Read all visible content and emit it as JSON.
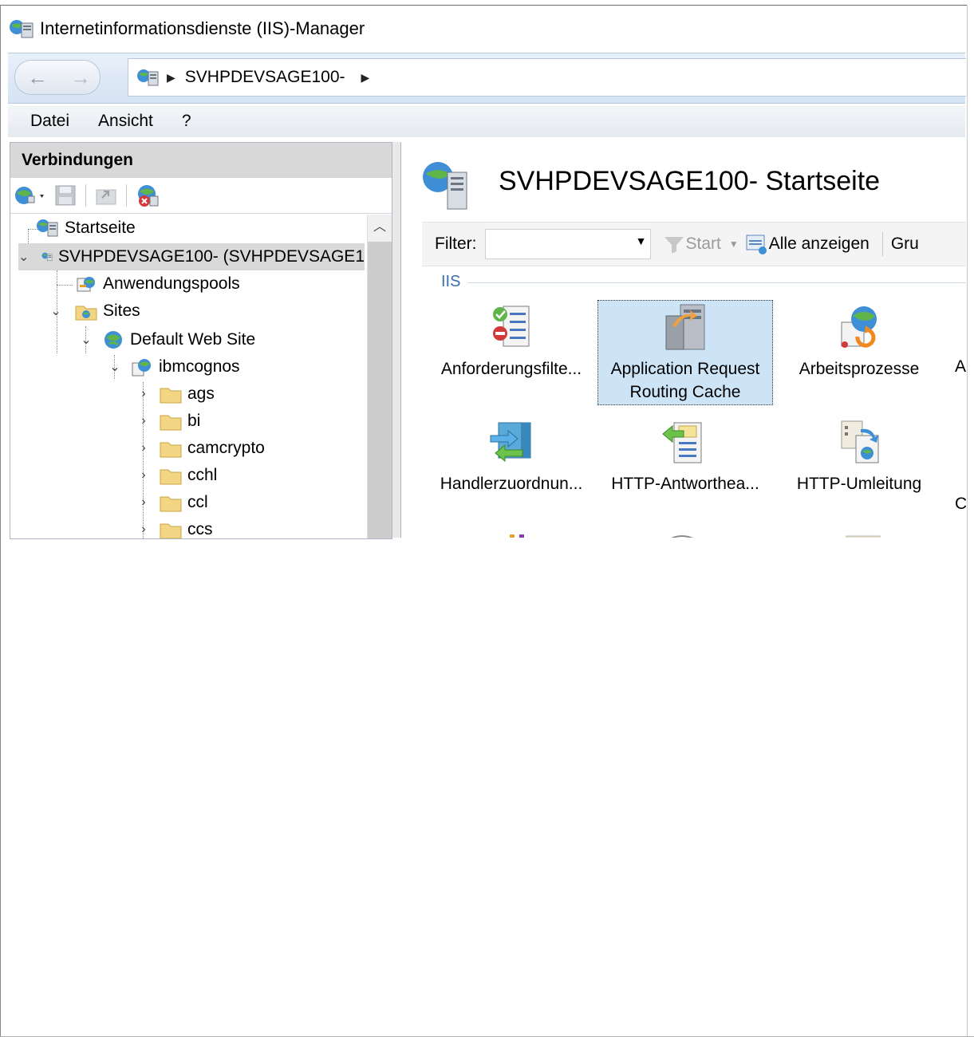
{
  "window": {
    "title": "Internetinformationsdienste (IIS)-Manager"
  },
  "addressbar": {
    "crumbs": [
      "SVHPDEVSAGE100-"
    ],
    "back_glyph": "←",
    "forward_glyph": "→"
  },
  "menu": [
    "Datei",
    "Ansicht",
    "?"
  ],
  "connections": {
    "header": "Verbindungen",
    "tree": [
      {
        "label": "Startseite",
        "icon": "server-icon"
      },
      {
        "label": "SVHPDEVSAGE100- (SVHPDEVSAGE1",
        "icon": "server-icon",
        "expanded": true,
        "selected": true
      },
      {
        "label": "Anwendungspools",
        "icon": "app-pool-icon"
      },
      {
        "label": "Sites",
        "icon": "sites-folder-icon",
        "expanded": true
      },
      {
        "label": "Default Web Site",
        "icon": "globe-icon",
        "expanded": true
      },
      {
        "label": "ibmcognos",
        "icon": "web-app-icon",
        "expanded": true
      },
      {
        "label": "ags",
        "icon": "folder-icon"
      },
      {
        "label": "bi",
        "icon": "folder-icon"
      },
      {
        "label": "camcrypto",
        "icon": "folder-icon"
      },
      {
        "label": "cchl",
        "icon": "folder-icon"
      },
      {
        "label": "ccl",
        "icon": "folder-icon"
      },
      {
        "label": "ccs",
        "icon": "folder-icon"
      }
    ]
  },
  "main": {
    "title": "SVHPDEVSAGE100- Startseite",
    "filter": {
      "label": "Filter:",
      "value": ""
    },
    "start_label": "Start",
    "show_all_label": "Alle anzeigen",
    "group_label": "Gru",
    "section": "IIS",
    "features": [
      {
        "label": "Anforderungsfilte...",
        "icon": "request-filtering-icon"
      },
      {
        "label": "Application Request Routing Cache",
        "icon": "arr-cache-icon",
        "selected": true
      },
      {
        "label": "Arbeitsprozesse",
        "icon": "worker-processes-icon"
      },
      {
        "label": "Handlerzuordnun...",
        "icon": "handler-mappings-icon"
      },
      {
        "label": "HTTP-Antworthea...",
        "icon": "http-response-headers-icon"
      },
      {
        "label": "HTTP-Umleitung",
        "icon": "http-redirect-icon"
      }
    ],
    "clipped_letters": [
      "A",
      "C"
    ]
  }
}
